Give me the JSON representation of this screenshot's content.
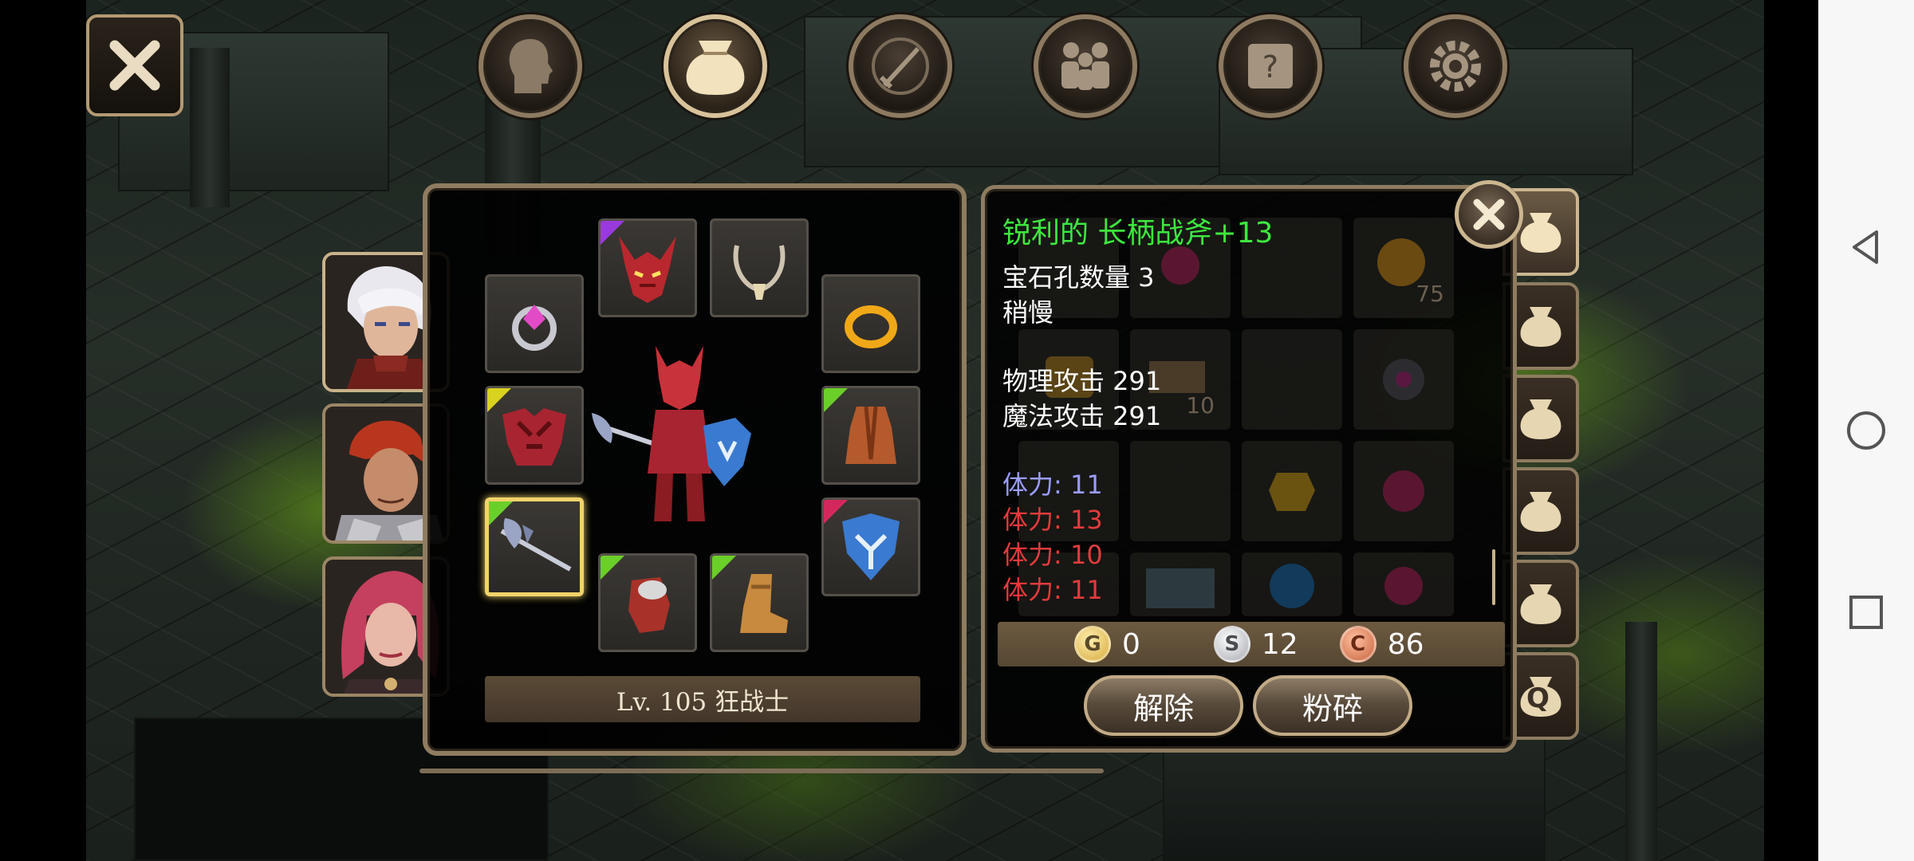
{
  "top_tabs": [
    {
      "name": "character",
      "icon": "head-icon"
    },
    {
      "name": "bag",
      "icon": "bag-icon",
      "active": true
    },
    {
      "name": "skills",
      "icon": "sword-icon"
    },
    {
      "name": "party",
      "icon": "people-icon"
    },
    {
      "name": "quest",
      "icon": "scroll-icon"
    },
    {
      "name": "settings",
      "icon": "gear-icon"
    }
  ],
  "equipment": {
    "level_label": "Lv. 105 狂战士"
  },
  "item_info": {
    "title": "锐利的 长柄战斧+13",
    "socket_line": "宝石孔数量 3",
    "speed_line": "稍慢",
    "phys_attack": "物理攻击 291",
    "magic_attack": "魔法攻击 291",
    "bonus_stats": [
      "体力: 11",
      "体力: 13",
      "体力: 10",
      "体力: 11"
    ],
    "bonus_colors": [
      "#9a9cff",
      "#e23b3b",
      "#e23b3b",
      "#e23b3b"
    ]
  },
  "inventory_counts": {
    "cell_a": "75",
    "cell_b": "10"
  },
  "currency": {
    "gold_letter": "G",
    "silver_letter": "S",
    "copper_letter": "C",
    "gold": "0",
    "silver": "12",
    "copper": "86"
  },
  "actions": {
    "unequip": "解除",
    "smash": "粉碎"
  },
  "bag_tabs": {
    "last_letter": "Q"
  },
  "colors": {
    "title_green": "#3ee83e",
    "selected_gold": "#f1d36a",
    "frame": "#8f7c60"
  }
}
